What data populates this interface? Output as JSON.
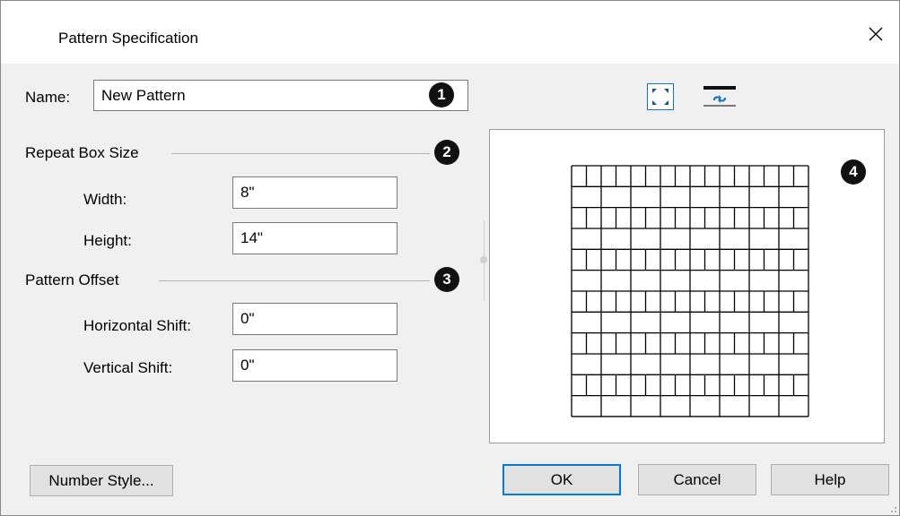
{
  "dialog": {
    "title": "Pattern Specification"
  },
  "name_field": {
    "label": "Name:",
    "value": "New Pattern"
  },
  "repeat_box": {
    "heading": "Repeat Box Size",
    "width_label": "Width:",
    "width_value": "8\"",
    "height_label": "Height:",
    "height_value": "14\""
  },
  "pattern_offset": {
    "heading": "Pattern Offset",
    "horizontal_label": "Horizontal Shift:",
    "horizontal_value": "0\"",
    "vertical_label": "Vertical Shift:",
    "vertical_value": "0\""
  },
  "callouts": [
    "1",
    "2",
    "3",
    "4"
  ],
  "preview_toolbar": {
    "icons": [
      "fill-window-icon",
      "update-preview-icon"
    ],
    "accent_color": "#1a73c8"
  },
  "buttons": {
    "number_style": "Number Style...",
    "ok": "OK",
    "cancel": "Cancel",
    "help": "Help"
  },
  "colors": {
    "dialog_bg": "#f0f0f0",
    "default_button_border": "#0078d7"
  }
}
